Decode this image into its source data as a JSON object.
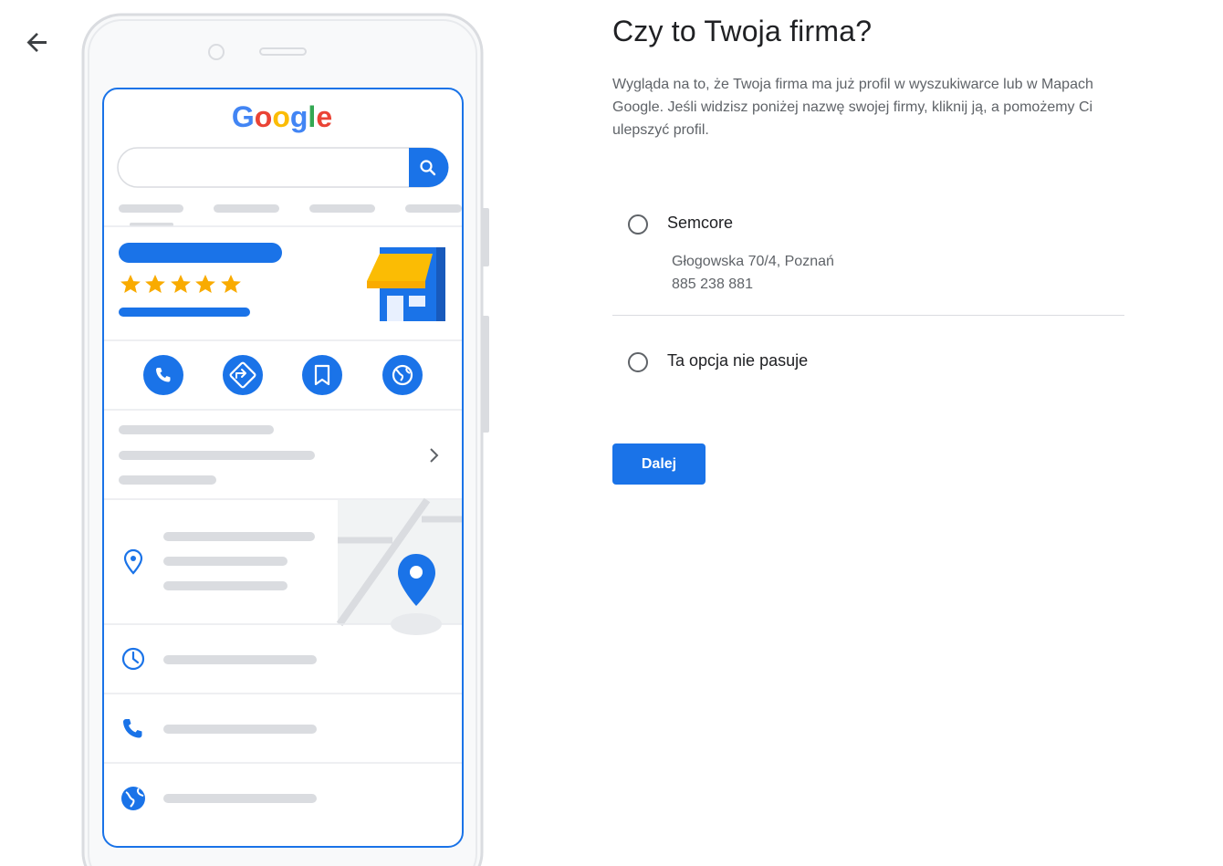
{
  "header": {
    "back_icon": "arrow-back-icon"
  },
  "illustration": {
    "logo_text": "Google",
    "logo_colors": [
      "#4285F4",
      "#EA4335",
      "#FBBC05",
      "#4285F4",
      "#34A853",
      "#EA4335"
    ],
    "rating_stars": 5,
    "accent": "#1a73e8"
  },
  "main": {
    "title": "Czy to Twoja firma?",
    "description": "Wygląda na to, że Twoja firma ma już profil w wyszukiwarce lub w Mapach Google. Jeśli widzisz poniżej nazwę swojej firmy, kliknij ją, a pomożemy Ci ulepszyć profil.",
    "options": [
      {
        "label": "Semcore",
        "address": "Głogowska 70/4, Poznań",
        "phone": "885 238 881"
      },
      {
        "label": "Ta opcja nie pasuje"
      }
    ],
    "next_label": "Dalej"
  }
}
